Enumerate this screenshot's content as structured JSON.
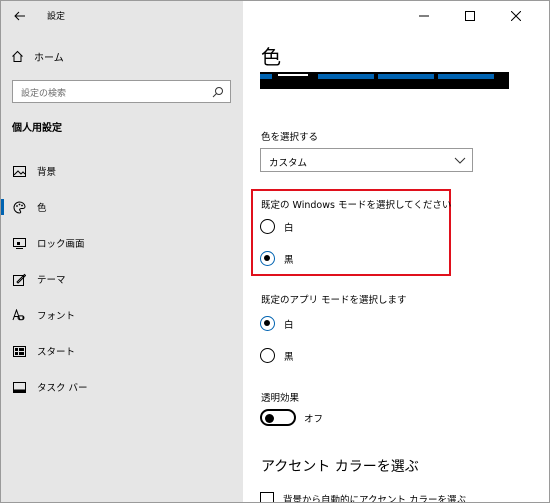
{
  "window": {
    "app_title": "設定",
    "controls": [
      "minimize",
      "maximize",
      "close"
    ]
  },
  "sidebar": {
    "home_label": "ホーム",
    "search_placeholder": "設定の検索",
    "section_title": "個人用設定",
    "items": [
      {
        "label": "背景",
        "icon": "image-icon"
      },
      {
        "label": "色",
        "icon": "palette-icon",
        "active": true
      },
      {
        "label": "ロック画面",
        "icon": "lock-screen-icon"
      },
      {
        "label": "テーマ",
        "icon": "theme-icon"
      },
      {
        "label": "フォント",
        "icon": "font-icon"
      },
      {
        "label": "スタート",
        "icon": "start-icon"
      },
      {
        "label": "タスク バー",
        "icon": "taskbar-icon"
      }
    ]
  },
  "main": {
    "page_title": "色",
    "choose_color_label": "色を選択する",
    "choose_color_value": "カスタム",
    "windows_mode_label": "既定の Windows モードを選択してください",
    "windows_mode_options": [
      {
        "label": "白",
        "selected": false
      },
      {
        "label": "黒",
        "selected": true
      }
    ],
    "app_mode_label": "既定のアプリ モードを選択します",
    "app_mode_options": [
      {
        "label": "白",
        "selected": true
      },
      {
        "label": "黒",
        "selected": false
      }
    ],
    "transparency_label": "透明効果",
    "transparency_state": "オフ",
    "accent_title": "アクセント カラーを選ぶ",
    "auto_accent_label": "背景から自動的にアクセント カラーを選ぶ"
  },
  "colors": {
    "accent": "#0063b1",
    "highlight": "#e0101c",
    "sidebar_bg": "#e6e6e6"
  }
}
